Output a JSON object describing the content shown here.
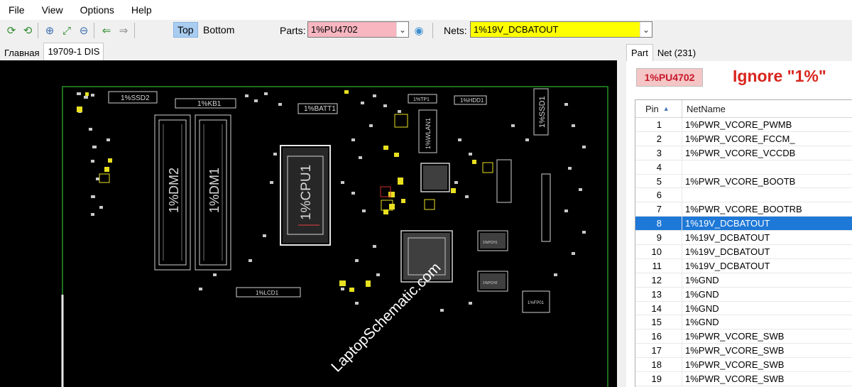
{
  "menu": {
    "items": [
      "File",
      "View",
      "Options",
      "Help"
    ]
  },
  "toolbar": {
    "icons": [
      "refresh-icon",
      "reload-icon",
      "zoom-in-icon",
      "fit-icon",
      "zoom-out-icon",
      "back-arrow-icon",
      "forward-arrow-icon"
    ],
    "top_label": "Top",
    "bottom_label": "Bottom",
    "parts_label": "Parts:",
    "parts_value": "1%PU4702",
    "nets_label": "Nets:",
    "nets_value": "1%19V_DCBATOUT",
    "parts_bg": "#f7b6c0",
    "nets_bg": "#ffff00"
  },
  "tabs": [
    "Главная",
    "19709-1 DIS"
  ],
  "board": {
    "labels": [
      "1%SSD2",
      "1%KB1",
      "1%BATT1",
      "1%TP1",
      "1%HDD1",
      "1%SSD1",
      "1%WLAN1",
      "1%DM2",
      "1%DM1",
      "1%CPU1",
      "1%LCD1",
      "1%PCH1",
      "1%PCH2",
      "1%FP01"
    ],
    "watermark": "LaptopSchematic.com",
    "outline_color": "#1e6e1e"
  },
  "right_panel": {
    "tabs": [
      "Part",
      "Net (231)"
    ],
    "part_badge": "1%PU4702",
    "note": "Ignore \"1%\"",
    "columns": {
      "pin": "Pin",
      "net": "NetName"
    },
    "rows": [
      {
        "pin": "1",
        "net": "1%PWR_VCORE_PWMB"
      },
      {
        "pin": "2",
        "net": "1%PWR_VCORE_FCCM_"
      },
      {
        "pin": "3",
        "net": "1%PWR_VCORE_VCCDB"
      },
      {
        "pin": "4",
        "net": ""
      },
      {
        "pin": "5",
        "net": "1%PWR_VCORE_BOOTB"
      },
      {
        "pin": "6",
        "net": ""
      },
      {
        "pin": "7",
        "net": "1%PWR_VCORE_BOOTRB"
      },
      {
        "pin": "8",
        "net": "1%19V_DCBATOUT"
      },
      {
        "pin": "9",
        "net": "1%19V_DCBATOUT"
      },
      {
        "pin": "10",
        "net": "1%19V_DCBATOUT"
      },
      {
        "pin": "11",
        "net": "1%19V_DCBATOUT"
      },
      {
        "pin": "12",
        "net": "1%GND"
      },
      {
        "pin": "13",
        "net": "1%GND"
      },
      {
        "pin": "14",
        "net": "1%GND"
      },
      {
        "pin": "15",
        "net": "1%GND"
      },
      {
        "pin": "16",
        "net": "1%PWR_VCORE_SWB"
      },
      {
        "pin": "17",
        "net": "1%PWR_VCORE_SWB"
      },
      {
        "pin": "18",
        "net": "1%PWR_VCORE_SWB"
      },
      {
        "pin": "19",
        "net": "1%PWR_VCORE_SWB"
      }
    ],
    "selected_pin": "8"
  }
}
